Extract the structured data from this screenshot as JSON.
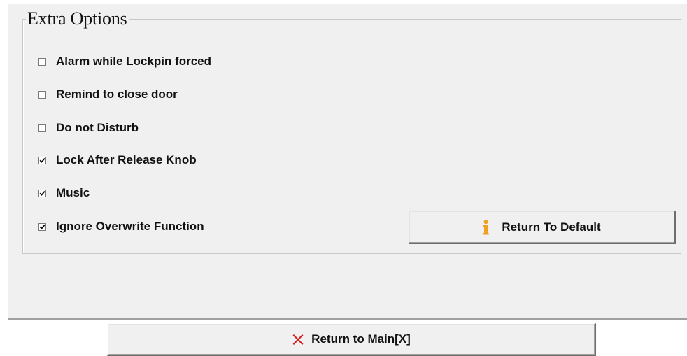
{
  "group": {
    "title": "Extra Options"
  },
  "options": [
    {
      "label": "Alarm while Lockpin forced",
      "checked": false
    },
    {
      "label": "Remind to close door",
      "checked": false
    },
    {
      "label": "Do not Disturb",
      "checked": false
    },
    {
      "label": "Lock After Release Knob",
      "checked": true
    },
    {
      "label": "Music",
      "checked": true
    },
    {
      "label": "Ignore Overwrite Function",
      "checked": true
    }
  ],
  "buttons": {
    "return_default_label": "Return To Default",
    "return_default_icon": "info-icon",
    "return_main_label": "Return to Main[X]",
    "return_main_icon": "red-x-icon"
  },
  "colors": {
    "panel_bg": "#f0f0f0",
    "info_icon": "#f0a020",
    "close_icon": "#d42020"
  }
}
